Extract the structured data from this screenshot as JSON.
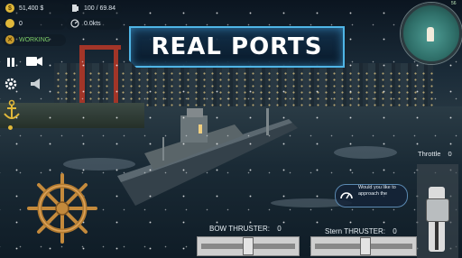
{
  "hud": {
    "money": "51,400 $",
    "fuel": "100 / 69.84",
    "coins": "0",
    "speed": "0.0kts",
    "status": "WORKING"
  },
  "banner": {
    "title": "REAL PORTS"
  },
  "radar": {
    "number": "56"
  },
  "throttle": {
    "label": "Throttle",
    "value": "0",
    "level": 0
  },
  "bow_thruster": {
    "label": "BOW THRUSTER:",
    "value": "0"
  },
  "stern_thruster": {
    "label": "Stern THRUSTER:",
    "value": "0"
  },
  "hint": {
    "text": "Would you like to approach the"
  },
  "colors": {
    "banner_border": "#4fb5e6",
    "status_green": "#7fd06a",
    "gold": "#e0b83a"
  },
  "icons": [
    "coin-icon",
    "fuel-icon",
    "speedometer-icon",
    "anchor-crossed-icon",
    "pause-icon",
    "camera-icon",
    "gear-icon",
    "horn-icon",
    "anchor-icon",
    "ship-wheel-icon",
    "gauge-icon"
  ]
}
